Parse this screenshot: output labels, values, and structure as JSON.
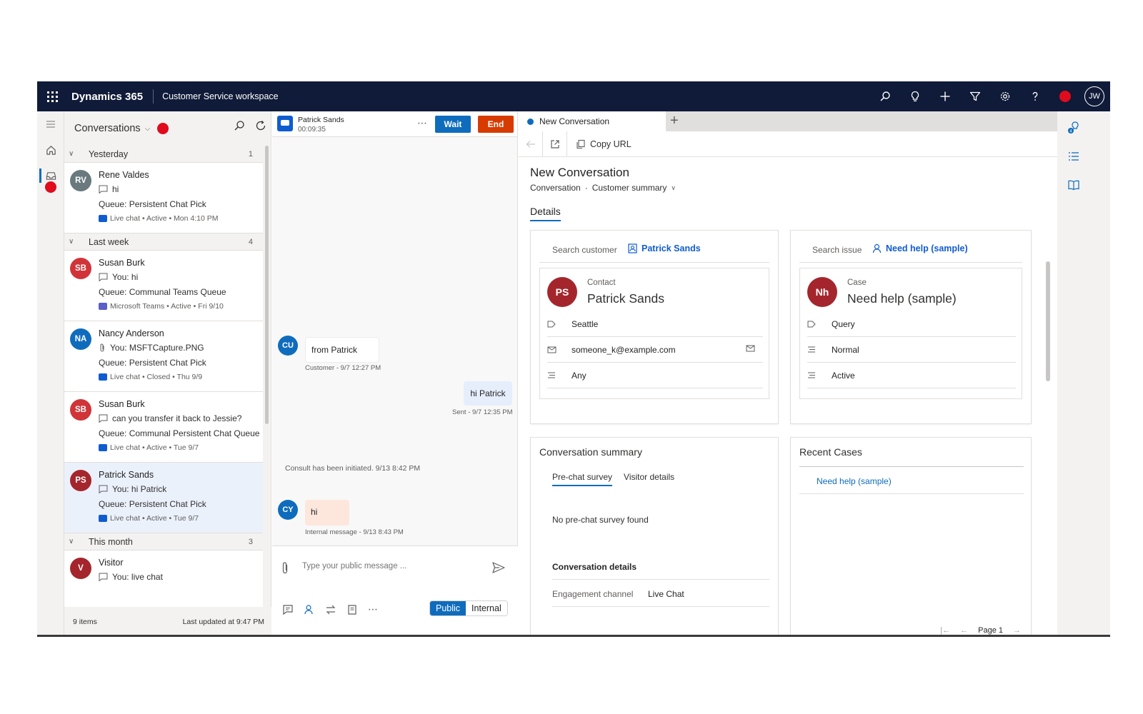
{
  "app": {
    "brand": "Dynamics 365",
    "workspace": "Customer Service workspace",
    "user_initials": "JW"
  },
  "colors": {
    "topbar": "#0f1b38",
    "accent": "#0f6cbd",
    "end_button": "#d83b01",
    "presence_busy": "#e00b1c",
    "customer_bubble": "#ffffff",
    "agent_bubble": "#e6eefc",
    "internal_bubble": "#fde7dd"
  },
  "conversations": {
    "title": "Conversations",
    "footer_count": "9 items",
    "footer_updated": "Last updated at 9:47 PM",
    "groups": [
      {
        "label": "Yesterday",
        "count": "1",
        "items": [
          {
            "initials": "RV",
            "avatar_color": "#69797e",
            "name": "Rene Valdes",
            "message": "hi",
            "message_icon": "chat-bubble-icon",
            "queue": "Queue: Persistent Chat Pick",
            "channel_icon": "live-chat-icon",
            "meta": "Live chat • Active • Mon 4:10 PM"
          }
        ]
      },
      {
        "label": "Last week",
        "count": "4",
        "items": [
          {
            "initials": "SB",
            "avatar_color": "#d13438",
            "name": "Susan Burk",
            "message": "You: hi",
            "message_icon": "chat-bubble-icon",
            "queue": "Queue: Communal Teams Queue",
            "channel_icon": "teams-icon",
            "meta": "Microsoft Teams • Active • Fri 9/10"
          },
          {
            "initials": "NA",
            "avatar_color": "#0f6cbd",
            "name": "Nancy Anderson",
            "message": "You: MSFTCapture.PNG",
            "message_icon": "paperclip-icon",
            "queue": "Queue: Persistent Chat Pick",
            "channel_icon": "live-chat-icon",
            "meta": "Live chat • Closed • Thu 9/9"
          },
          {
            "initials": "SB",
            "avatar_color": "#d13438",
            "name": "Susan Burk",
            "message": "can you transfer it back to Jessie?",
            "message_icon": "chat-bubble-icon",
            "queue": "Queue: Communal Persistent Chat Queue",
            "channel_icon": "live-chat-icon",
            "meta": "Live chat • Active • Tue 9/7"
          },
          {
            "initials": "PS",
            "avatar_color": "#a4262c",
            "name": "Patrick Sands",
            "message": "You: hi Patrick",
            "message_icon": "chat-bubble-icon",
            "queue": "Queue: Persistent Chat Pick",
            "channel_icon": "live-chat-icon",
            "meta": "Live chat • Active • Tue 9/7",
            "selected": true
          }
        ]
      },
      {
        "label": "This month",
        "count": "3",
        "items": [
          {
            "initials": "V",
            "avatar_color": "#a4262c",
            "name": "Visitor",
            "message": "You: live chat",
            "message_icon": "chat-bubble-icon",
            "queue": "",
            "channel_icon": "",
            "meta": ""
          }
        ]
      }
    ]
  },
  "chat": {
    "customer_name": "Patrick Sands",
    "timer": "00:09:35",
    "wait_label": "Wait",
    "end_label": "End",
    "messages": {
      "m1_avatar": "CU",
      "m1_text": "from Patrick",
      "m1_meta": "Customer - 9/7 12:27 PM",
      "m2_text": "hi Patrick",
      "m2_meta": "Sent - 9/7 12:35 PM",
      "system": "Consult has been initiated. 9/13 8:42 PM",
      "m3_avatar": "CY",
      "m3_text": "hi",
      "m3_meta": "Internal message - 9/13 8:43 PM"
    },
    "compose_placeholder": "Type your public message ...",
    "public_label": "Public",
    "internal_label": "Internal"
  },
  "main": {
    "tab_label": "New Conversation",
    "copy_url": "Copy URL",
    "title": "New Conversation",
    "entity": "Conversation",
    "form_name": "Customer summary",
    "details_tab": "Details",
    "customer_card": {
      "search_label": "Search customer",
      "search_value": "Patrick Sands",
      "record_initials": "PS",
      "record_type": "Contact",
      "record_name": "Patrick Sands",
      "rows": [
        "Seattle",
        "someone_k@example.com",
        "Any"
      ]
    },
    "issue_card": {
      "search_label": "Search issue",
      "search_value": "Need help (sample)",
      "record_initials": "Nh",
      "record_type": "Case",
      "record_name": "Need help (sample)",
      "rows": [
        "Query",
        "Normal",
        "Active"
      ]
    },
    "summary_card": {
      "title": "Conversation summary",
      "tabs": [
        "Pre-chat survey",
        "Visitor details"
      ],
      "empty": "No pre-chat survey found",
      "details_title": "Conversation details",
      "channel_label": "Engagement channel",
      "channel_value": "Live Chat"
    },
    "recent_cases": {
      "title": "Recent Cases",
      "link": "Need help (sample)",
      "page": "Page 1"
    }
  }
}
